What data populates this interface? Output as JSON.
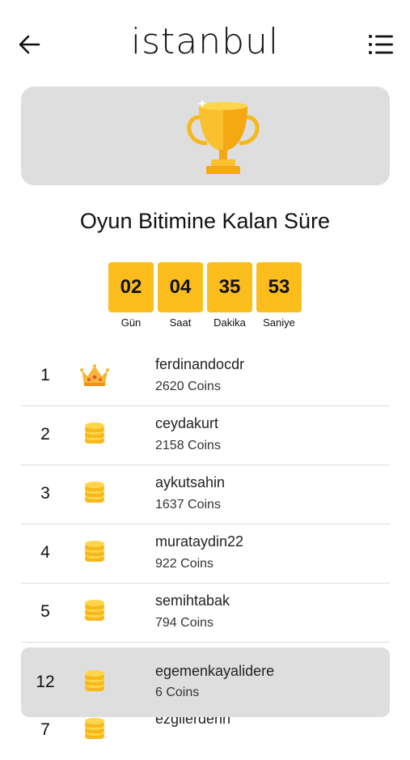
{
  "header": {
    "title": "istanbul"
  },
  "countdown": {
    "title": "Oyun Bitimine Kalan Süre",
    "units": [
      {
        "value": "02",
        "label": "Gün"
      },
      {
        "value": "04",
        "label": "Saat"
      },
      {
        "value": "35",
        "label": "Dakika"
      },
      {
        "value": "53",
        "label": "Saniye"
      }
    ]
  },
  "leaderboard": [
    {
      "rank": "1",
      "icon": "crown-icon",
      "username": "ferdinandocdr",
      "coins": "2620 Coins"
    },
    {
      "rank": "2",
      "icon": "coins-icon",
      "username": "ceydakurt",
      "coins": "2158 Coins"
    },
    {
      "rank": "3",
      "icon": "coins-icon",
      "username": "aykutsahin",
      "coins": "1637 Coins"
    },
    {
      "rank": "4",
      "icon": "coins-icon",
      "username": "murataydin22",
      "coins": "922 Coins"
    },
    {
      "rank": "5",
      "icon": "coins-icon",
      "username": "semihtabak",
      "coins": "794 Coins"
    },
    {
      "rank": "7",
      "icon": "coins-icon",
      "username": "ezgilerdenn",
      "coins": ""
    }
  ],
  "current_user": {
    "rank": "12",
    "icon": "coins-icon",
    "username": "egemenkayalidere",
    "coins": "6 Coins"
  },
  "colors": {
    "accent": "#fbbd1c",
    "card": "#dedede"
  }
}
